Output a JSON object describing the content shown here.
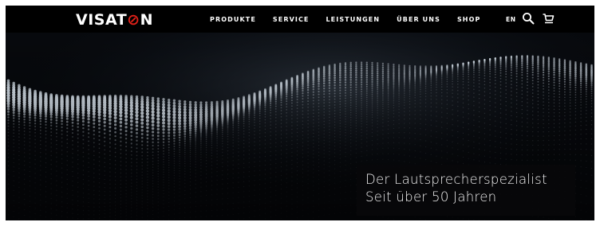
{
  "brand": {
    "prefix": "VISAT",
    "mark": "⊘",
    "suffix": "N",
    "mark_color": "#e32119"
  },
  "nav": {
    "items": [
      {
        "label": "PRODUKTE"
      },
      {
        "label": "SERVICE"
      },
      {
        "label": "LEISTUNGEN"
      },
      {
        "label": "ÜBER UNS"
      },
      {
        "label": "SHOP"
      }
    ],
    "language": "EN",
    "icons": [
      "search-icon",
      "cart-icon"
    ]
  },
  "hero": {
    "line1": "Der Lautsprecherspezialist",
    "line2": "Seit über 50 Jahren",
    "background": "#07090d",
    "caption_bg": "#08080a"
  }
}
